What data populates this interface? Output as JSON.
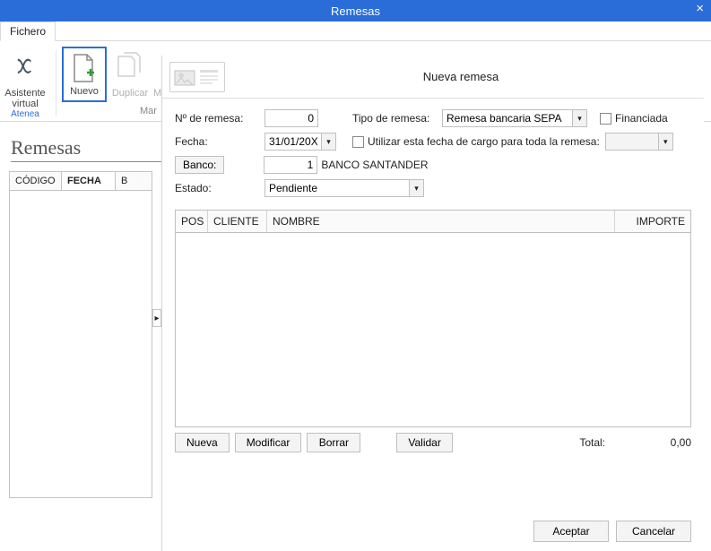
{
  "window": {
    "title": "Remesas"
  },
  "menubar": {
    "fichero": "Fichero"
  },
  "ribbon": {
    "asistente": "Asistente\nvirtual",
    "asistente_sub": "Atenea",
    "nuevo": "Nuevo",
    "duplicar": "Duplicar",
    "mod": "M",
    "mar": "Mar"
  },
  "section": {
    "title": "Remesas"
  },
  "back_grid": {
    "codigo": "CÓDIGO",
    "fecha": "FECHA",
    "b": "B"
  },
  "modal": {
    "title": "Nueva remesa",
    "labels": {
      "num_remesa": "Nº de remesa:",
      "tipo_remesa": "Tipo de remesa:",
      "financiada": "Financiada",
      "fecha": "Fecha:",
      "usar_fecha": "Utilizar esta fecha de cargo para toda la remesa:",
      "banco": "Banco:",
      "estado": "Estado:"
    },
    "values": {
      "num_remesa": "0",
      "tipo_remesa": "Remesa bancaria SEPA",
      "fecha": "31/01/20XX",
      "banco_codigo": "1",
      "banco_nombre": "BANCO SANTANDER",
      "estado": "Pendiente"
    },
    "grid_headers": {
      "pos": "POS",
      "cliente": "CLIENTE",
      "nombre": "NOMBRE",
      "importe": "IMPORTE"
    },
    "buttons": {
      "nueva": "Nueva",
      "modificar": "Modificar",
      "borrar": "Borrar",
      "validar": "Validar"
    },
    "total_label": "Total:",
    "total_value": "0,00",
    "footer": {
      "aceptar": "Aceptar",
      "cancelar": "Cancelar"
    }
  }
}
